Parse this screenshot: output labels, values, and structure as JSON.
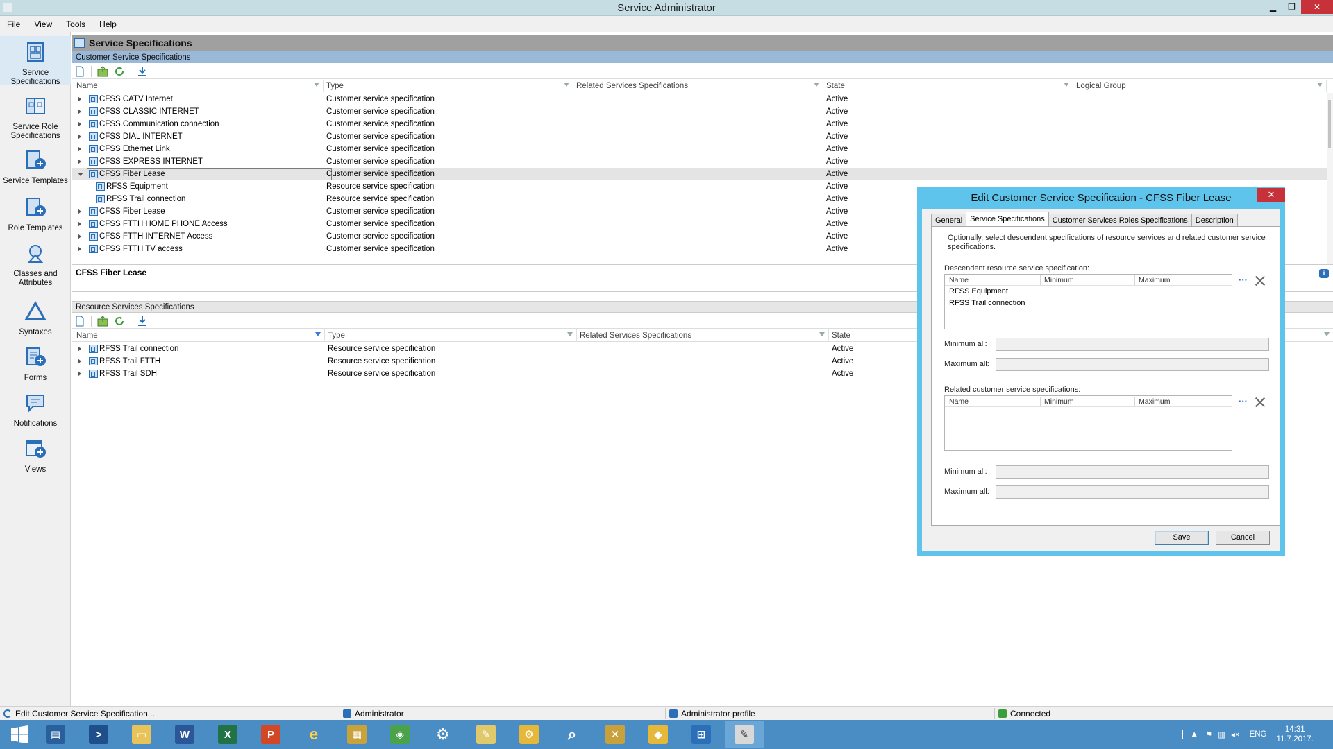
{
  "window": {
    "title": "Service Administrator",
    "min_glyph": "▁",
    "restore_glyph": "❐",
    "close_glyph": "✕"
  },
  "menu": [
    "File",
    "View",
    "Tools",
    "Help"
  ],
  "nav": [
    {
      "label": "Service Specifications",
      "icon": "service-specifications-icon"
    },
    {
      "label": "Service Role Specifications",
      "icon": "service-role-specifications-icon"
    },
    {
      "label": "Service Templates",
      "icon": "service-templates-icon"
    },
    {
      "label": "Role Templates",
      "icon": "role-templates-icon"
    },
    {
      "label": "Classes and Attributes",
      "icon": "classes-attributes-icon"
    },
    {
      "label": "Syntaxes",
      "icon": "syntaxes-icon"
    },
    {
      "label": "Forms",
      "icon": "forms-icon"
    },
    {
      "label": "Notifications",
      "icon": "notifications-icon"
    },
    {
      "label": "Views",
      "icon": "views-icon"
    }
  ],
  "panel": {
    "title": "Service Specifications",
    "customer_section": "Customer Service Specifications",
    "resource_section": "Resource Services Specifications",
    "detail_title": "CFSS Fiber Lease"
  },
  "customer_grid": {
    "columns": [
      "Name",
      "Type",
      "Related Services Specifications",
      "State",
      "Logical Group"
    ],
    "rows": [
      {
        "name": "CFSS CATV Internet",
        "type": "Customer service specification",
        "state": "Active"
      },
      {
        "name": "CFSS CLASSIC INTERNET",
        "type": "Customer service specification",
        "state": "Active"
      },
      {
        "name": "CFSS Communication connection",
        "type": "Customer service specification",
        "state": "Active"
      },
      {
        "name": "CFSS DIAL INTERNET",
        "type": "Customer service specification",
        "state": "Active"
      },
      {
        "name": "CFSS Ethernet Link",
        "type": "Customer service specification",
        "state": "Active"
      },
      {
        "name": "CFSS EXPRESS INTERNET",
        "type": "Customer service specification",
        "state": "Active"
      },
      {
        "name": "CFSS Fiber Lease",
        "type": "Customer service specification",
        "state": "Active"
      },
      {
        "name": "RFSS Equipment",
        "type": "Resource service specification",
        "state": "Active"
      },
      {
        "name": "RFSS Trail connection",
        "type": "Resource service specification",
        "state": "Active"
      },
      {
        "name": "CFSS Fiber Lease",
        "type": "Customer service specification",
        "state": "Active"
      },
      {
        "name": "CFSS FTTH HOME PHONE Access",
        "type": "Customer service specification",
        "state": "Active"
      },
      {
        "name": "CFSS FTTH INTERNET Access",
        "type": "Customer service specification",
        "state": "Active"
      },
      {
        "name": "CFSS FTTH TV access",
        "type": "Customer service specification",
        "state": "Active"
      }
    ]
  },
  "resource_grid": {
    "columns": [
      "Name",
      "Type",
      "Related Services Specifications",
      "State"
    ],
    "rows": [
      {
        "name": "RFSS Trail connection",
        "type": "Resource service specification",
        "state": "Active"
      },
      {
        "name": "RFSS Trail FTTH",
        "type": "Resource service specification",
        "state": "Active"
      },
      {
        "name": "RFSS Trail SDH",
        "type": "Resource service specification",
        "state": "Active"
      }
    ]
  },
  "dialog": {
    "title": "Edit Customer Service Specification - CFSS Fiber Lease",
    "close_glyph": "✕",
    "tabs": [
      "General",
      "Service Specifications",
      "Customer Services Roles Specifications",
      "Description"
    ],
    "description": "Optionally, select descendent specifications of resource services and related customer service specifications.",
    "descendent_label": "Descendent resource service specification:",
    "related_label": "Related customer service specifications:",
    "mini_columns": [
      "Name",
      "Minimum",
      "Maximum"
    ],
    "descendent_rows": [
      "RFSS Equipment",
      "RFSS Trail connection"
    ],
    "min_all_label": "Minimum all:",
    "max_all_label": "Maximum all:",
    "dots": "···",
    "save": "Save",
    "cancel": "Cancel"
  },
  "status": {
    "task": "Edit Customer Service Specification...",
    "user": "Administrator",
    "profile": "Administrator profile",
    "connection": "Connected"
  },
  "taskbar": {
    "lang": "ENG",
    "time": "14:31",
    "date": "11.7.2017."
  },
  "colors": {
    "accent": "#5ec4ec",
    "section": "#9ab8d8",
    "taskbar": "#4a8dc4",
    "close": "#c7313a"
  }
}
